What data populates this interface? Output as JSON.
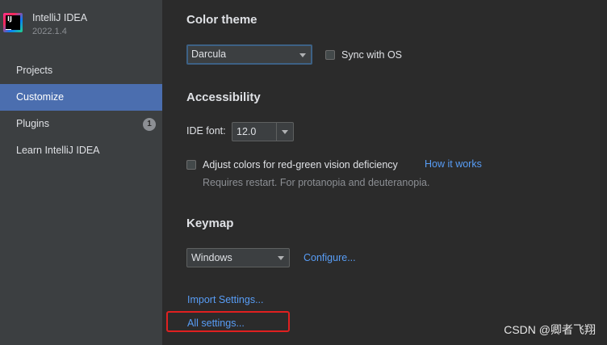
{
  "app": {
    "name": "IntelliJ IDEA",
    "version": "2022.1.4",
    "logo_text": "IJ"
  },
  "sidebar": {
    "items": [
      {
        "label": "Projects",
        "active": false
      },
      {
        "label": "Customize",
        "active": true
      },
      {
        "label": "Plugins",
        "active": false,
        "badge": "1"
      },
      {
        "label": "Learn IntelliJ IDEA",
        "active": false
      }
    ]
  },
  "color_theme": {
    "title": "Color theme",
    "selected": "Darcula",
    "sync_label": "Sync with OS",
    "sync_checked": false
  },
  "accessibility": {
    "title": "Accessibility",
    "ide_font_label": "IDE font:",
    "ide_font_value": "12.0",
    "adjust_colors_label": "Adjust colors for red-green vision deficiency",
    "adjust_colors_checked": false,
    "how_it_works_link": "How it works",
    "restart_hint": "Requires restart. For protanopia and deuteranopia."
  },
  "keymap": {
    "title": "Keymap",
    "selected": "Windows",
    "configure_link": "Configure..."
  },
  "footer": {
    "import_settings_link": "Import Settings...",
    "all_settings_link": "All settings..."
  },
  "watermark": "CSDN @卿者飞翔",
  "colors": {
    "sidebar_bg": "#3c3f41",
    "main_bg": "#2b2b2b",
    "active_item_bg": "#4b6eaf",
    "link": "#589df6",
    "highlight_border": "#e02020"
  }
}
